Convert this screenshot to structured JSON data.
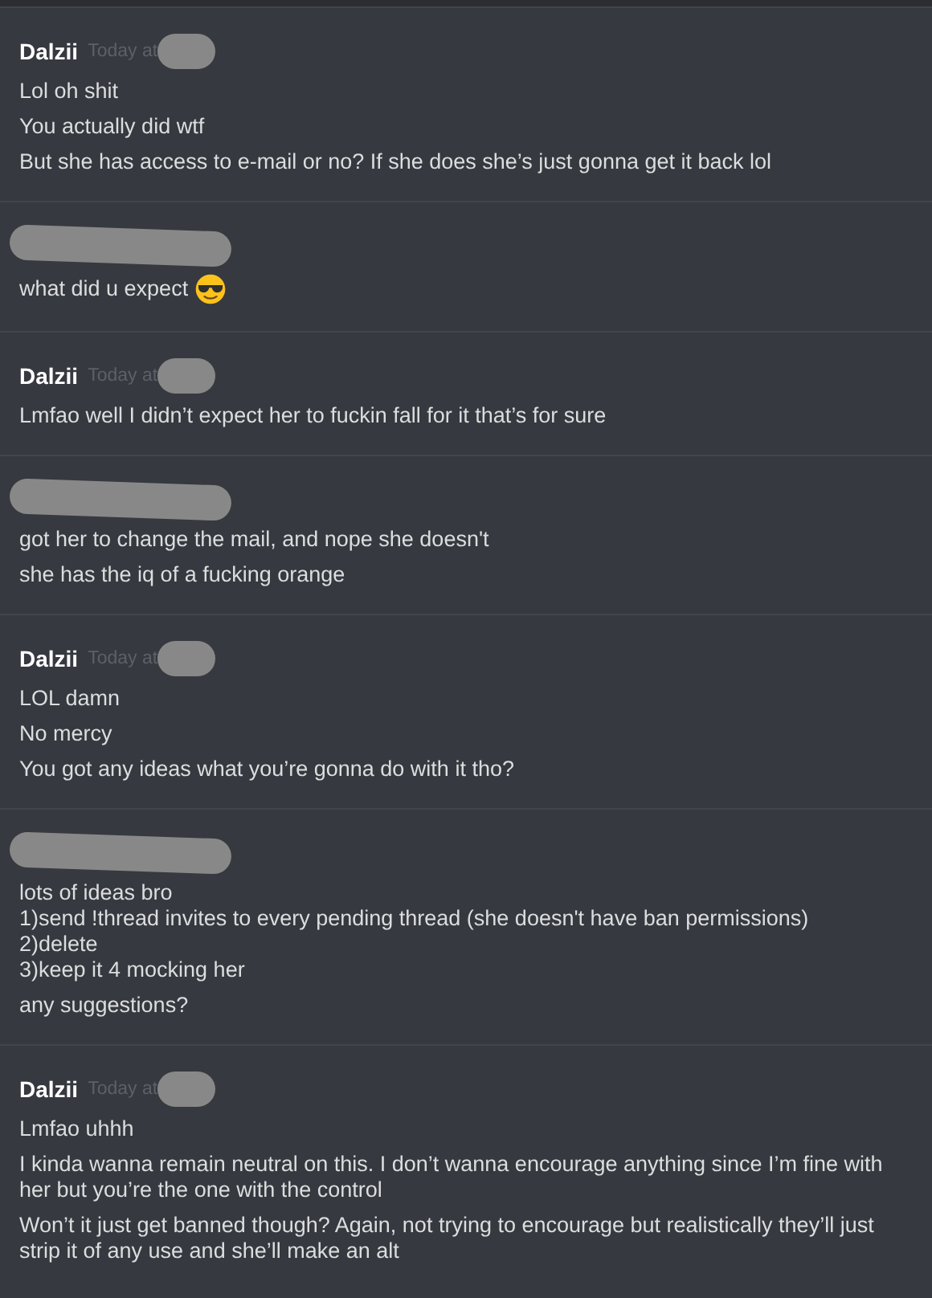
{
  "messages": [
    {
      "author": "Dalzii",
      "author_redacted": false,
      "timestamp": "Today at",
      "timestamp_redacted": true,
      "blocks": [
        {
          "text": "Lol oh shit"
        },
        {
          "text": "You actually did wtf"
        },
        {
          "text": "But she has access to e-mail or no? If she does she’s just gonna get it back lol"
        }
      ]
    },
    {
      "author_redacted": true,
      "blocks": [
        {
          "text": "what did u expect",
          "trailing_emoji": true
        }
      ]
    },
    {
      "author": "Dalzii",
      "author_redacted": false,
      "timestamp": "Today at",
      "timestamp_redacted": true,
      "blocks": [
        {
          "text": "Lmfao well I didn’t expect her to fuckin fall for it that’s for sure"
        }
      ]
    },
    {
      "author_redacted": true,
      "blocks": [
        {
          "text": "got her to change the mail, and nope she doesn't"
        },
        {
          "text": "she has the iq of a fucking orange"
        }
      ]
    },
    {
      "author": "Dalzii",
      "author_redacted": false,
      "timestamp": "Today at",
      "timestamp_redacted": true,
      "blocks": [
        {
          "text": "LOL damn"
        },
        {
          "text": "No mercy"
        },
        {
          "text": "You got any ideas what you’re gonna do with it tho?"
        }
      ]
    },
    {
      "author_redacted": true,
      "blocks": [
        {
          "text": "lots of ideas bro\n1)send !thread invites to every pending thread (she doesn't have ban permissions)\n2)delete\n3)keep it 4 mocking her"
        },
        {
          "text": "any suggestions?"
        }
      ]
    },
    {
      "author": "Dalzii",
      "author_redacted": false,
      "timestamp": "Today at",
      "timestamp_redacted": true,
      "blocks": [
        {
          "text": "Lmfao uhhh"
        },
        {
          "text": "I kinda wanna remain neutral on this. I don’t wanna encourage anything since I’m fine with her but you’re the one with the control"
        },
        {
          "text": "Won’t it just get banned though? Again, not trying to encourage but realistically they’ll just strip it of any use and she’ll make an alt"
        }
      ]
    }
  ]
}
